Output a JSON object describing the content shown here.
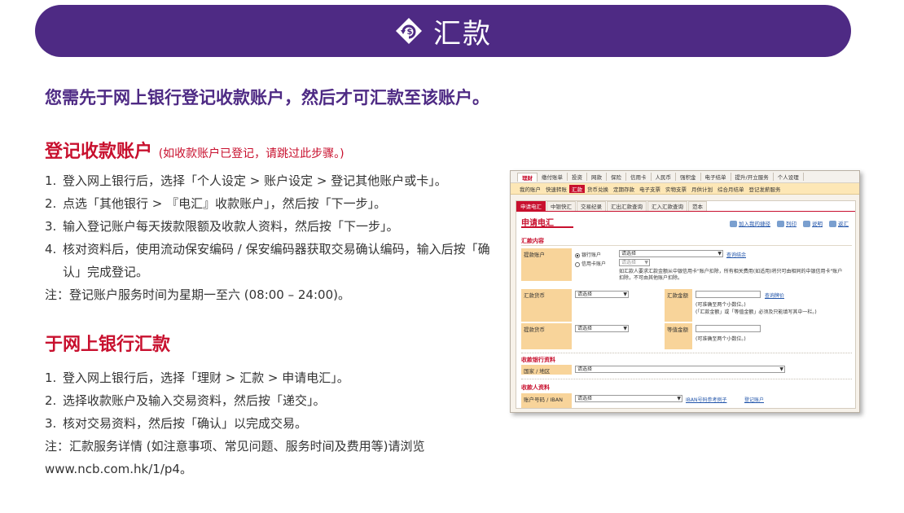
{
  "banner": {
    "title": "汇款",
    "icon": "remittance-icon"
  },
  "lead": "您需先于网上银行登记收款账户，然后才可汇款至该账户。",
  "section1": {
    "title": "登记收款账户",
    "subtitle": "(如收款账户已登记，请跳过此步骤。)",
    "steps": [
      {
        "n": "1.",
        "t": "登入网上银行后，选择「个人设定 > 账户设定 > 登记其他账户或卡」。"
      },
      {
        "n": "2.",
        "t": "点选「其他银行 > 『电汇』收款账户」，然后按「下一步」。"
      },
      {
        "n": "3.",
        "t": "输入登记账户每天拨款限额及收款人资料，然后按「下一步」。"
      },
      {
        "n": "4.",
        "t": "核对资料后，使用流动保安编码 / 保安编码器获取交易确认编码，输入后按「确认」完成登记。"
      }
    ],
    "note": "注：登记账户服务时间为星期一至六 (08:00 – 24:00)。"
  },
  "section2": {
    "title": "于网上银行汇款",
    "steps": [
      {
        "n": "1.",
        "t": "登入网上银行后，选择「理财 > 汇款 > 申请电汇」。"
      },
      {
        "n": "2.",
        "t": "选择收款账户及输入交易资料，然后按「递交」。"
      },
      {
        "n": "3.",
        "t": "核对交易资料，然后按「确认」以完成交易。"
      }
    ],
    "note": "注：汇款服务详情 (如注意事项、常见问题、服务时间及费用等)请浏览www.ncb.com.hk/1/p4。"
  },
  "shot": {
    "nav1": [
      "理财",
      "缴付账单",
      "投资",
      "网款",
      "保险",
      "信用卡",
      "人民币",
      "强积金",
      "电子结单",
      "提升/开立服务",
      "个人设理"
    ],
    "nav2": [
      "我的账户",
      "快速转账",
      "汇款",
      "货币兑换",
      "定期存款",
      "电子支票",
      "实物支票",
      "月供计划",
      "综合月结单",
      "登记发薪服务"
    ],
    "tabs": [
      "申请电汇",
      "中银快汇",
      "交易纪录",
      "汇出汇款查询",
      "汇入汇款查询",
      "范本"
    ],
    "title": "申请电汇",
    "tools": [
      "加入我的捷径",
      "列印",
      "说明",
      "返汇"
    ],
    "sec_remit": "汇款内容",
    "debit_label": "提款账户",
    "radio_bank": "银行账户",
    "radio_card": "信用卡账户",
    "select_placeholder": "请选择",
    "balance_link": "查询结余",
    "card_note": "如汇款人要求汇款金额从中银信用卡\"账户扣除，所有相关费用(如适用)将只可由相同的中银信用卡\"账户扣除，不可由其他账户扣除。",
    "currency_label": "汇款货币",
    "amount_label": "汇款金额",
    "rate_link": "查询牌价",
    "amount_hint1": "(可准确至两个小数位。)",
    "amount_hint2": "(「汇款金额」或「等值金额」必须及只能填写其中一栏。)",
    "debit_ccy_label": "提款货币",
    "equiv_label": "等值金额",
    "equiv_hint": "(可准确至两个小数位。)",
    "sec_bank": "收款银行资料",
    "country_label": "国家 / 地区",
    "sec_payee": "收款人资料",
    "acct_label": "账户号码 / IBAN",
    "iban_link": "IBAN号码参考例子",
    "register_link": "登记账户"
  }
}
